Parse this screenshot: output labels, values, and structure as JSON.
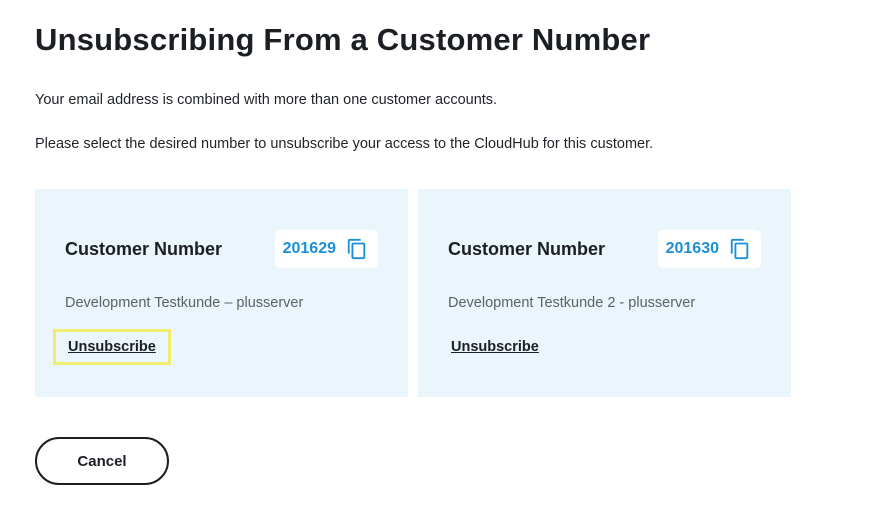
{
  "page": {
    "title": "Unsubscribing From a Customer Number",
    "intro_1": "Your email address is combined with more than one customer accounts.",
    "intro_2": "Please select the desired number to unsubscribe your access to the CloudHub for this customer."
  },
  "cards": [
    {
      "label": "Customer Number",
      "number": "201629",
      "icon": "copy-icon",
      "description": "Development Testkunde – plusserver",
      "action": "Unsubscribe",
      "highlighted": true
    },
    {
      "label": "Customer Number",
      "number": "201630",
      "icon": "copy-icon",
      "description": "Development Testkunde 2 - plusserver",
      "action": "Unsubscribe",
      "highlighted": false
    }
  ],
  "footer": {
    "cancel_label": "Cancel"
  },
  "colors": {
    "card_background": "#eaf6fb",
    "number_accent": "#1a8fd6",
    "highlight_border": "#f0ec6e",
    "text_primary": "#1b1f24",
    "text_secondary": "#5c6166"
  }
}
